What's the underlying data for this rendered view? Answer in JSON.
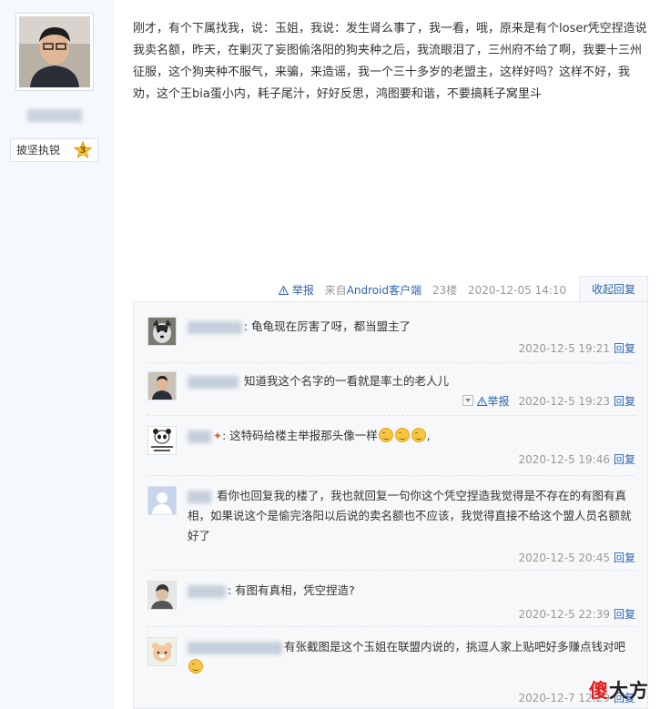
{
  "author": {
    "badge_label": "披坚执锐",
    "badge_level": "3"
  },
  "post": {
    "content": "刚才，有个下属找我，说：玉姐，我说：发生肾么事了，我一看，哦，原来是有个loser凭空捏造说我卖名额，昨天，在剿灭了妄图偷洛阳的狗夹种之后，我流眼泪了，三州府不给了啊，我要十三州征服，这个狗夹种不服气，来骗，来造谣，我一个三十多岁的老盟主，这样好吗？这样不好，我劝，这个王bia蛋小内，耗子尾汁，好好反思，鸿图要和谐，不要搞耗子窝里斗",
    "report_label": "举报",
    "source": "来自Android客户端",
    "floor": "23楼",
    "time": "2020-12-05 14:10",
    "collapse_label": "收起回复"
  },
  "replies": [
    {
      "text": ": 龟龟现在厉害了呀，都当盟主了",
      "time": "2020-12-5 19:21",
      "reply_label": "回复"
    },
    {
      "text": "知道我这个名字的一看就是率土的老人儿",
      "time": "2020-12-5 19:23",
      "reply_label": "回复",
      "report_label": "举报"
    },
    {
      "text": ": 这特码给楼主举报那头像一样",
      "time": "2020-12-5 19:46",
      "reply_label": "回复"
    },
    {
      "text": "看你也回复我的楼了，我也就回复一句你这个凭空捏造我觉得是不存在的有图有真相，如果说这个是偷完洛阳以后说的卖名额也不应该，我觉得直接不给这个盟人员名额就好了",
      "time": "2020-12-5 20:45",
      "reply_label": "回复"
    },
    {
      "text": ": 有图有真相，凭空捏造?",
      "time": "2020-12-5 22:39",
      "reply_label": "回复"
    },
    {
      "text": "有张截图是这个玉姐在联盟内说的，挑逗人家上贴吧好多赚点钱对吧",
      "time": "2020-12-7 12:29",
      "reply_label": "回复"
    }
  ],
  "watermark": {
    "part1": "傻",
    "part2": "大方"
  },
  "icons": {
    "report": "warning-triangle-icon",
    "dropdown": "chevron-down-icon",
    "level": "star-icon"
  }
}
